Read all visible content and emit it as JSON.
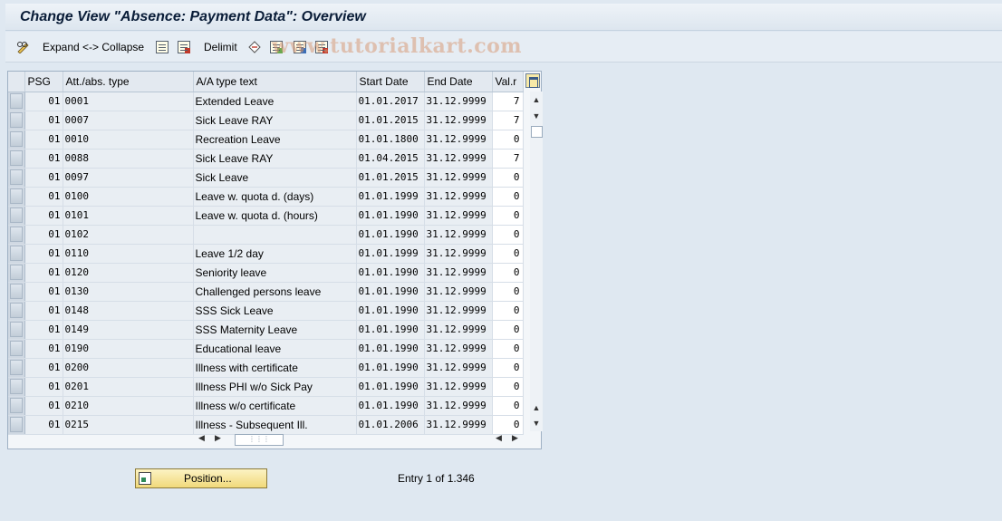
{
  "title": "Change View \"Absence: Payment Data\": Overview",
  "toolbar": {
    "expand_collapse_label": "Expand <-> Collapse",
    "delimit_label": "Delimit"
  },
  "watermark": "www.tutorialkart.com",
  "table": {
    "columns": [
      "PSG",
      "Att./abs. type",
      "A/A type text",
      "Start Date",
      "End Date",
      "Val.r"
    ],
    "rows": [
      {
        "psg": "01",
        "type": "0001",
        "text": "Extended Leave",
        "start": "01.01.2017",
        "end": "31.12.9999",
        "val": "7"
      },
      {
        "psg": "01",
        "type": "0007",
        "text": "Sick Leave RAY",
        "start": "01.01.2015",
        "end": "31.12.9999",
        "val": "7"
      },
      {
        "psg": "01",
        "type": "0010",
        "text": "Recreation Leave",
        "start": "01.01.1800",
        "end": "31.12.9999",
        "val": "0"
      },
      {
        "psg": "01",
        "type": "0088",
        "text": "Sick Leave RAY",
        "start": "01.04.2015",
        "end": "31.12.9999",
        "val": "7"
      },
      {
        "psg": "01",
        "type": "0097",
        "text": "Sick Leave",
        "start": "01.01.2015",
        "end": "31.12.9999",
        "val": "0"
      },
      {
        "psg": "01",
        "type": "0100",
        "text": "Leave w. quota d. (days)",
        "start": "01.01.1999",
        "end": "31.12.9999",
        "val": "0"
      },
      {
        "psg": "01",
        "type": "0101",
        "text": "Leave w. quota d. (hours)",
        "start": "01.01.1990",
        "end": "31.12.9999",
        "val": "0"
      },
      {
        "psg": "01",
        "type": "0102",
        "text": "",
        "start": "01.01.1990",
        "end": "31.12.9999",
        "val": "0"
      },
      {
        "psg": "01",
        "type": "0110",
        "text": "Leave 1/2 day",
        "start": "01.01.1999",
        "end": "31.12.9999",
        "val": "0"
      },
      {
        "psg": "01",
        "type": "0120",
        "text": "Seniority leave",
        "start": "01.01.1990",
        "end": "31.12.9999",
        "val": "0"
      },
      {
        "psg": "01",
        "type": "0130",
        "text": "Challenged persons leave",
        "start": "01.01.1990",
        "end": "31.12.9999",
        "val": "0"
      },
      {
        "psg": "01",
        "type": "0148",
        "text": "SSS Sick Leave",
        "start": "01.01.1990",
        "end": "31.12.9999",
        "val": "0"
      },
      {
        "psg": "01",
        "type": "0149",
        "text": "SSS Maternity Leave",
        "start": "01.01.1990",
        "end": "31.12.9999",
        "val": "0"
      },
      {
        "psg": "01",
        "type": "0190",
        "text": "Educational leave",
        "start": "01.01.1990",
        "end": "31.12.9999",
        "val": "0"
      },
      {
        "psg": "01",
        "type": "0200",
        "text": "Illness with certificate",
        "start": "01.01.1990",
        "end": "31.12.9999",
        "val": "0"
      },
      {
        "psg": "01",
        "type": "0201",
        "text": "Illness PHI w/o Sick Pay",
        "start": "01.01.1990",
        "end": "31.12.9999",
        "val": "0"
      },
      {
        "psg": "01",
        "type": "0210",
        "text": "Illness w/o certificate",
        "start": "01.01.1990",
        "end": "31.12.9999",
        "val": "0"
      },
      {
        "psg": "01",
        "type": "0215",
        "text": "Illness - Subsequent Ill.",
        "start": "01.01.2006",
        "end": "31.12.9999",
        "val": "0"
      }
    ]
  },
  "position_button_label": "Position...",
  "entry_info": "Entry 1 of 1.346"
}
